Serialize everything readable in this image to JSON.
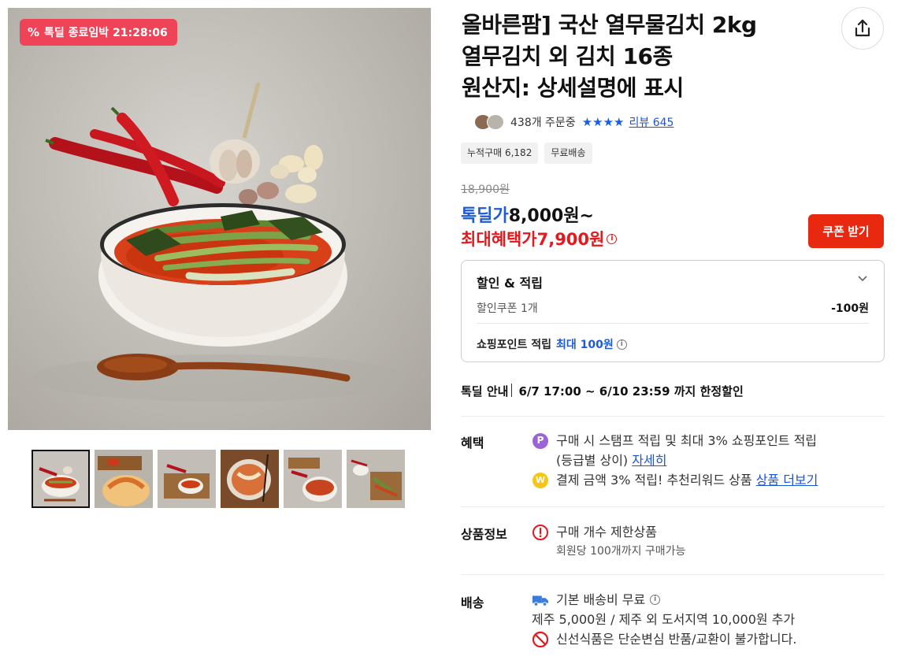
{
  "gallery": {
    "timer_text": "톡딜 종료임박 21:28:06",
    "thumbnails": [
      "thumb-1",
      "thumb-2",
      "thumb-3",
      "thumb-4",
      "thumb-5",
      "thumb-6"
    ],
    "active_thumbnail": 0
  },
  "product": {
    "title_line1": "올바른팜] 국산 열무물김치 2kg",
    "title_line2": "열무김치 외 김치 16종",
    "title_line3": "원산지: 상세설명에 표시"
  },
  "social": {
    "orders": "438개 주문중",
    "stars": "★★★★",
    "review_link": "리뷰 645"
  },
  "tags": [
    "누적구매 6,182",
    "무료배송"
  ],
  "price": {
    "original": "18,900원",
    "deal_label": "톡딜가",
    "deal_value": "8,000원~",
    "max_label": "최대혜택가",
    "max_value": "7,900원",
    "info_glyph": "i",
    "coupon_button": "쿠폰 받기"
  },
  "benefit_box": {
    "heading": "할인 & 적립",
    "coupon_label": "할인쿠폰 1개",
    "coupon_amount": "-100원",
    "point_label": "쇼핑포인트 적립",
    "point_value": "최대 100원"
  },
  "deal_info": {
    "label": "톡딜 안내",
    "text": "6/7 17:00 ~ 6/10 23:59 까지 한정할인"
  },
  "benefits": {
    "label": "혜택",
    "line1": "구매 시 스탬프 적립 및 최대 3% 쇼핑포인트 적립",
    "line2": "(등급별 상이)",
    "line2_link": "자세히",
    "line3": "결제 금액 3% 적립! 추천리워드 상품",
    "line3_link": "상품 더보기",
    "p_glyph": "P",
    "w_glyph": "W"
  },
  "product_info": {
    "label": "상품정보",
    "line1": "구매 개수 제한상품",
    "line2": "회원당 100개까지 구매가능"
  },
  "shipping": {
    "label": "배송",
    "line1": "기본 배송비 무료",
    "line2": "제주 5,000원 / 제주 외 도서지역 10,000원 추가",
    "line3": "신선식품은 단순변심 반품/교환이 불가합니다."
  },
  "colors": {
    "deal_blue": "#1f5bd4",
    "price_red": "#e4191d",
    "coupon_button": "#e8290f",
    "timer_badge": "#ef4458"
  }
}
